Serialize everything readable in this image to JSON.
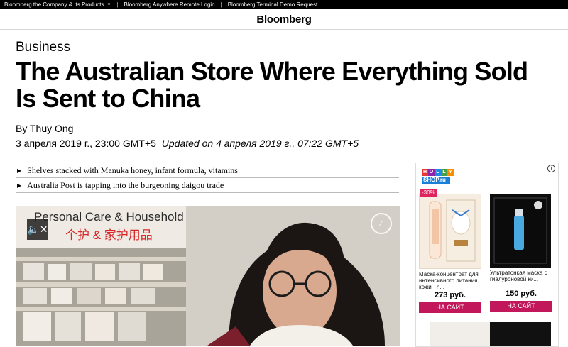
{
  "topbar": {
    "items": [
      "Bloomberg the Company & Its Products",
      "Bloomberg Anywhere Remote Login",
      "Bloomberg Terminal Demo Request"
    ]
  },
  "brand": "Bloomberg",
  "article": {
    "section": "Business",
    "headline": "The Australian Store Where Everything Sold Is Sent to China",
    "byline_prefix": "By",
    "author": "Thuy Ong",
    "published": "3 апреля 2019 г., 23:00 GMT+5",
    "updated_prefix": "Updated on",
    "updated": "4 апреля 2019 г., 07:22 GMT+5",
    "bullets": [
      "Shelves stacked with Manuka honey, infant formula, vitamins",
      "Australia Post is tapping into the burgeoning daigou trade"
    ]
  },
  "video": {
    "sign_en": "Personal Care & Household",
    "sign_cn": "个护 & 家护用品",
    "mute_icon": "mute-icon",
    "share_icon": "share-icon"
  },
  "ad": {
    "logo_top": [
      "H",
      "O",
      "L",
      "L",
      "Y"
    ],
    "logo_colors": [
      "#e53935",
      "#8e24aa",
      "#1e88e5",
      "#43a047",
      "#fb8c00"
    ],
    "logo_bottom": "SHOP.ru",
    "products": [
      {
        "discount": "-30%",
        "name": "Маска-концентрат для интенсивного питания кожи Тh...",
        "price": "273 руб.",
        "button": "НА САЙТ"
      },
      {
        "discount": "",
        "name": "Ультратонкая маска с гиалуроновой ки...",
        "price": "150 руб.",
        "button": "НА САЙТ"
      }
    ],
    "accent": "#c2185b"
  }
}
